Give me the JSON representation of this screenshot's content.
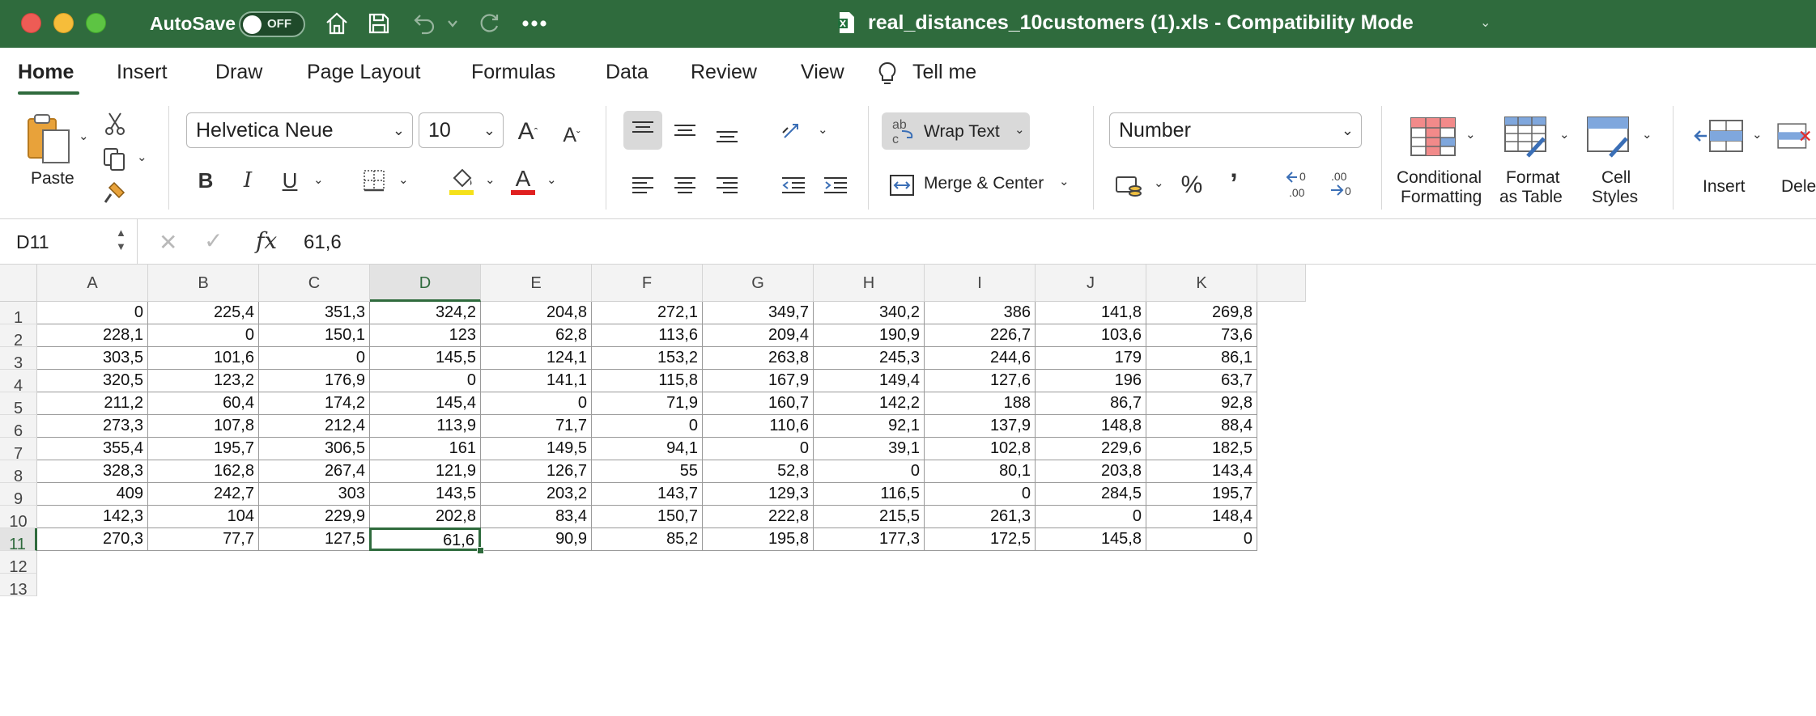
{
  "titlebar": {
    "autosave_label": "AutoSave",
    "autosave_state": "OFF",
    "document_title": "real_distances_10customers (1).xls  -  Compatibility Mode",
    "background_color": "#2f6b3d"
  },
  "tabs": [
    {
      "label": "Home",
      "active": true
    },
    {
      "label": "Insert"
    },
    {
      "label": "Draw"
    },
    {
      "label": "Page Layout"
    },
    {
      "label": "Formulas"
    },
    {
      "label": "Data"
    },
    {
      "label": "Review"
    },
    {
      "label": "View"
    },
    {
      "label": "Tell me",
      "icon": "lightbulb-icon"
    }
  ],
  "ribbon": {
    "paste_label": "Paste",
    "font_name": "Helvetica Neue",
    "font_size": "10",
    "wrap_text_label": "Wrap Text",
    "merge_center_label": "Merge & Center",
    "number_format": "Number",
    "conditional_formatting_line1": "Conditional",
    "conditional_formatting_line2": "Formatting",
    "format_as_table_line1": "Format",
    "format_as_table_line2": "as Table",
    "cell_styles_line1": "Cell",
    "cell_styles_line2": "Styles",
    "insert_label": "Insert",
    "delete_label": "Dele",
    "highlight_color": "#f5e11a",
    "font_color": "#e02020"
  },
  "formula_bar": {
    "name_box": "D11",
    "fx_label": "fx",
    "value": "61,6"
  },
  "sheet": {
    "columns": [
      "A",
      "B",
      "C",
      "D",
      "E",
      "F",
      "G",
      "H",
      "I",
      "J",
      "K"
    ],
    "selected_column": "D",
    "selected_row": 11,
    "row_numbers": [
      "1",
      "2",
      "3",
      "4",
      "5",
      "6",
      "7",
      "8",
      "9",
      "10",
      "11",
      "12",
      "13"
    ],
    "rows": [
      [
        "0",
        "225,4",
        "351,3",
        "324,2",
        "204,8",
        "272,1",
        "349,7",
        "340,2",
        "386",
        "141,8",
        "269,8"
      ],
      [
        "228,1",
        "0",
        "150,1",
        "123",
        "62,8",
        "113,6",
        "209,4",
        "190,9",
        "226,7",
        "103,6",
        "73,6"
      ],
      [
        "303,5",
        "101,6",
        "0",
        "145,5",
        "124,1",
        "153,2",
        "263,8",
        "245,3",
        "244,6",
        "179",
        "86,1"
      ],
      [
        "320,5",
        "123,2",
        "176,9",
        "0",
        "141,1",
        "115,8",
        "167,9",
        "149,4",
        "127,6",
        "196",
        "63,7"
      ],
      [
        "211,2",
        "60,4",
        "174,2",
        "145,4",
        "0",
        "71,9",
        "160,7",
        "142,2",
        "188",
        "86,7",
        "92,8"
      ],
      [
        "273,3",
        "107,8",
        "212,4",
        "113,9",
        "71,7",
        "0",
        "110,6",
        "92,1",
        "137,9",
        "148,8",
        "88,4"
      ],
      [
        "355,4",
        "195,7",
        "306,5",
        "161",
        "149,5",
        "94,1",
        "0",
        "39,1",
        "102,8",
        "229,6",
        "182,5"
      ],
      [
        "328,3",
        "162,8",
        "267,4",
        "121,9",
        "126,7",
        "55",
        "52,8",
        "0",
        "80,1",
        "203,8",
        "143,4"
      ],
      [
        "409",
        "242,7",
        "303",
        "143,5",
        "203,2",
        "143,7",
        "129,3",
        "116,5",
        "0",
        "284,5",
        "195,7"
      ],
      [
        "142,3",
        "104",
        "229,9",
        "202,8",
        "83,4",
        "150,7",
        "222,8",
        "215,5",
        "261,3",
        "0",
        "148,4"
      ],
      [
        "270,3",
        "77,7",
        "127,5",
        "61,6",
        "90,9",
        "85,2",
        "195,8",
        "177,3",
        "172,5",
        "145,8",
        "0"
      ]
    ]
  }
}
